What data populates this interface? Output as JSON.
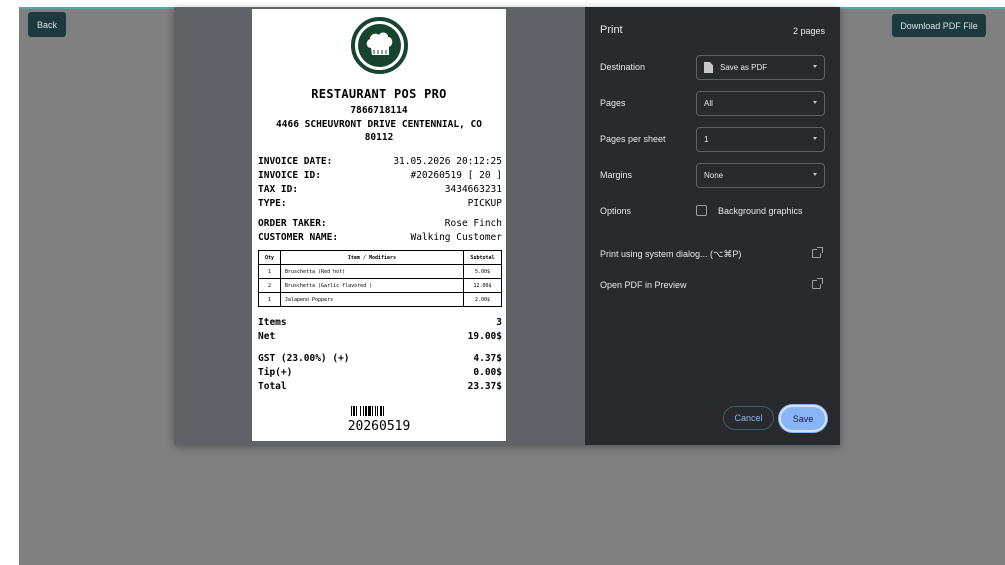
{
  "app": {
    "back_label": "Back",
    "download_label": "Download PDF File"
  },
  "receipt": {
    "name": "RESTAURANT POS PRO",
    "phone": "7866718114",
    "address": "4466 SCHEUVRONT DRIVE CENTENNIAL, CO 80112",
    "fields": [
      {
        "label": "INVOICE DATE:",
        "value": "31.05.2026 20:12:25"
      },
      {
        "label": "INVOICE ID:",
        "value": "#20260519 [ 20 ]"
      },
      {
        "label": "TAX ID:",
        "value": "3434663231"
      },
      {
        "label": "TYPE:",
        "value": "PICKUP"
      }
    ],
    "people": [
      {
        "label": "ORDER TAKER:",
        "value": "Rose Finch"
      },
      {
        "label": "CUSTOMER NAME:",
        "value": "Walking Customer"
      }
    ],
    "table_headers": {
      "qty": "Qty",
      "item": "Item / Modifiers",
      "subtotal": "Subtotal"
    },
    "items": [
      {
        "qty": "1",
        "item": "Bruschetta (Red hot)",
        "subtotal": "5.00$"
      },
      {
        "qty": "2",
        "item": "Bruschetta (Garlic flavored )",
        "subtotal": "12.00$"
      },
      {
        "qty": "1",
        "item": "Jalapeno Poppers",
        "subtotal": "2.00$"
      }
    ],
    "totals_a": [
      {
        "label": "Items",
        "value": "3"
      },
      {
        "label": "Net",
        "value": "19.00$"
      }
    ],
    "totals_b": [
      {
        "label": "GST (23.00%) (+)",
        "value": "4.37$"
      },
      {
        "label": "Tip(+)",
        "value": "0.00$"
      },
      {
        "label": "Total",
        "value": "23.37$"
      }
    ],
    "barcode_number": "20260519"
  },
  "print": {
    "title": "Print",
    "page_count": "2 pages",
    "destination_label": "Destination",
    "destination_value": "Save as PDF",
    "pages_label": "Pages",
    "pages_value": "All",
    "pages_per_sheet_label": "Pages per sheet",
    "pages_per_sheet_value": "1",
    "margins_label": "Margins",
    "margins_value": "None",
    "options_label": "Options",
    "background_graphics_label": "Background graphics",
    "background_graphics_checked": false,
    "system_dialog_label": "Print using system dialog... (⌥⌘P)",
    "open_preview_label": "Open PDF in Preview",
    "cancel_label": "Cancel",
    "save_label": "Save"
  },
  "colors": {
    "accent_teal": "#1d3b3f",
    "logo_green": "#17442f",
    "save_blue": "#8ab4f8",
    "dialog_dark": "#292a2d"
  }
}
